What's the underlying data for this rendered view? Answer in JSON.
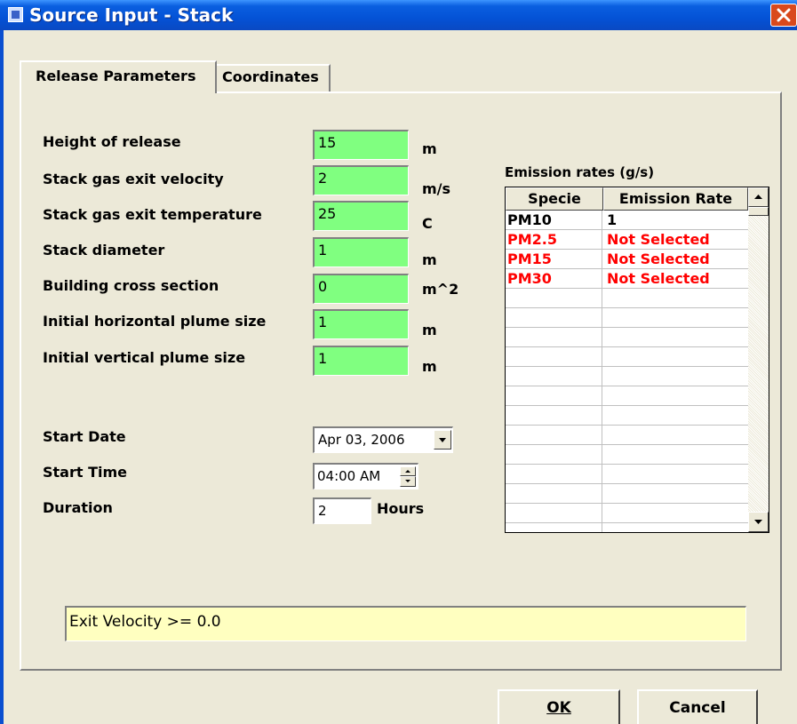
{
  "window": {
    "title": "Source Input - Stack"
  },
  "tabs": [
    {
      "label": "Release Parameters",
      "active": true
    },
    {
      "label": "Coordinates",
      "active": false
    }
  ],
  "params": [
    {
      "label": "Height of release",
      "value": "15",
      "unit": "m"
    },
    {
      "label": "Stack gas exit velocity",
      "value": "2",
      "unit": "m/s"
    },
    {
      "label": "Stack gas exit temperature",
      "value": "25",
      "unit": "C"
    },
    {
      "label": "Stack diameter",
      "value": "1",
      "unit": "m"
    },
    {
      "label": "Building cross section",
      "value": "0",
      "unit": "m^2"
    },
    {
      "label": "Initial horizontal plume size",
      "value": "1",
      "unit": "m"
    },
    {
      "label": "Initial vertical plume size",
      "value": "1",
      "unit": "m"
    }
  ],
  "timing": {
    "start_date_label": "Start Date",
    "start_date_value": "Apr 03, 2006",
    "start_time_label": "Start Time",
    "start_time_value": "04:00 AM",
    "duration_label": "Duration",
    "duration_value": "2",
    "duration_unit": "Hours"
  },
  "emissions": {
    "title": "Emission rates (g/s)",
    "columns": [
      "Specie",
      "Emission Rate"
    ],
    "rows": [
      {
        "specie": "PM10",
        "rate": "1",
        "color": "#000000"
      },
      {
        "specie": "PM2.5",
        "rate": "Not Selected",
        "color": "#ff0000"
      },
      {
        "specie": "PM15",
        "rate": "Not Selected",
        "color": "#ff0000"
      },
      {
        "specie": "PM30",
        "rate": "Not Selected",
        "color": "#ff0000"
      }
    ]
  },
  "status_message": "Exit Velocity >= 0.0",
  "buttons": {
    "ok": "OK",
    "cancel": "Cancel"
  }
}
